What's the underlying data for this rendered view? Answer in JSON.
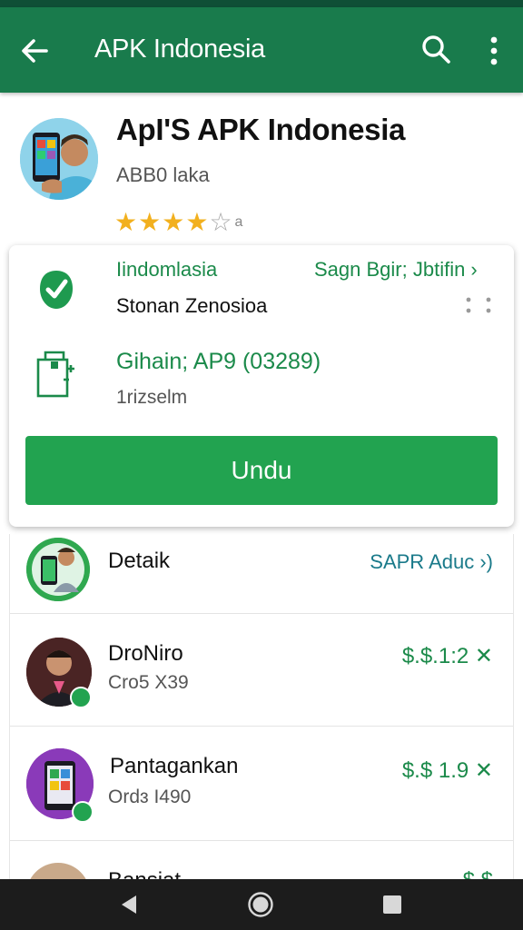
{
  "app_bar": {
    "title": "APK Indonesia",
    "back_icon": "arrow-left-icon",
    "search_icon": "search-icon",
    "more_icon": "more-vert-icon"
  },
  "app": {
    "name": "ApI'S APK Indonesia",
    "developer": "ABB0 laka",
    "rating": 4,
    "rating_max": 5,
    "rating_count": "a"
  },
  "card": {
    "verified_label": "Iindomlasia",
    "signed_link": "Sagn Bgir; Jbtifin",
    "store_name": "Stonan Zenosioa",
    "version_label": "Gihain; AP9 (03289)",
    "size_label": "1rizselm",
    "download_label": "Undu"
  },
  "list": {
    "rows": [
      {
        "name": "Detaik",
        "link": "SAPR Aduc ›)"
      },
      {
        "name": "DroNiro",
        "sub": "Cro5 X39",
        "price": "$.$.1:2"
      },
      {
        "name": "Pantagankan",
        "sub": "Ordɜ I490",
        "price": "$.$ 1.9"
      },
      {
        "name": "Bansiat",
        "price": "$.$"
      }
    ]
  },
  "colors": {
    "app_bar": "#197b4c",
    "accent_green": "#22a350",
    "star": "#f2b01e"
  },
  "navbar": {
    "back_icon": "nav-back-icon",
    "home_icon": "nav-home-icon",
    "recent_icon": "nav-recents-icon"
  }
}
